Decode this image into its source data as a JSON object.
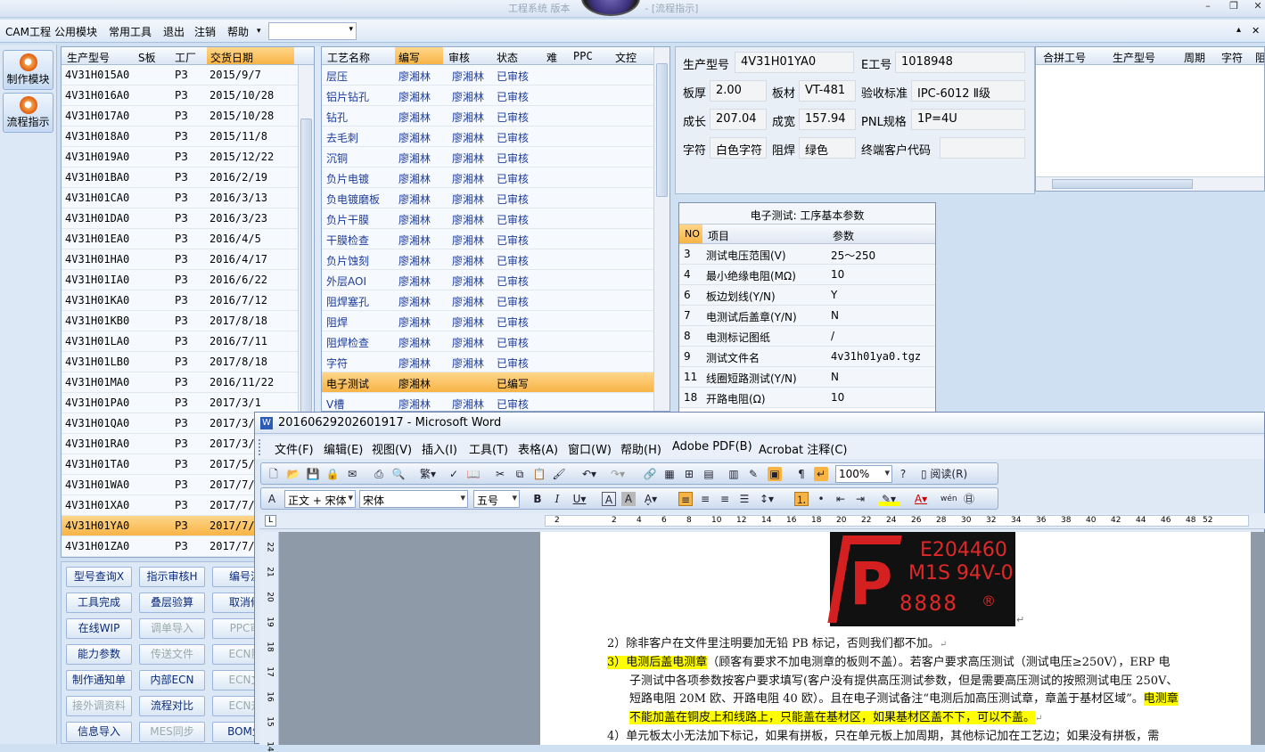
{
  "app": {
    "title": "工程系统   版本",
    "title_suffix": "- [流程指示]",
    "menu": [
      "CAM工程",
      "公用模块",
      "常用工具",
      "退出",
      "注销",
      "帮助"
    ],
    "menu_arrow": "▾",
    "window_controls": [
      "–",
      "❐",
      "✕"
    ],
    "mdi_controls": [
      "▴",
      "✕"
    ]
  },
  "leftnav": {
    "items": [
      {
        "label": "制作模块",
        "icon": "flame-icon"
      },
      {
        "label": "流程指示",
        "icon": "flame-icon"
      }
    ]
  },
  "models": {
    "headers": [
      "生产型号",
      "S板",
      "工厂",
      "交货日期"
    ],
    "rows": [
      [
        "4V31H015A0",
        "",
        "P3",
        "2015/9/7"
      ],
      [
        "4V31H016A0",
        "",
        "P3",
        "2015/10/28"
      ],
      [
        "4V31H017A0",
        "",
        "P3",
        "2015/10/28"
      ],
      [
        "4V31H018A0",
        "",
        "P3",
        "2015/11/8"
      ],
      [
        "4V31H019A0",
        "",
        "P3",
        "2015/12/22"
      ],
      [
        "4V31H01BA0",
        "",
        "P3",
        "2016/2/19"
      ],
      [
        "4V31H01CA0",
        "",
        "P3",
        "2016/3/13"
      ],
      [
        "4V31H01DA0",
        "",
        "P3",
        "2016/3/23"
      ],
      [
        "4V31H01EA0",
        "",
        "P3",
        "2016/4/5"
      ],
      [
        "4V31H01HA0",
        "",
        "P3",
        "2016/4/17"
      ],
      [
        "4V31H01IA0",
        "",
        "P3",
        "2016/6/22"
      ],
      [
        "4V31H01KA0",
        "",
        "P3",
        "2016/7/12"
      ],
      [
        "4V31H01KB0",
        "",
        "P3",
        "2017/8/18"
      ],
      [
        "4V31H01LA0",
        "",
        "P3",
        "2016/7/11"
      ],
      [
        "4V31H01LB0",
        "",
        "P3",
        "2017/8/18"
      ],
      [
        "4V31H01MA0",
        "",
        "P3",
        "2016/11/22"
      ],
      [
        "4V31H01PA0",
        "",
        "P3",
        "2017/3/1"
      ],
      [
        "4V31H01QA0",
        "",
        "P3",
        "2017/3/"
      ],
      [
        "4V31H01RA0",
        "",
        "P3",
        "2017/3/"
      ],
      [
        "4V31H01TA0",
        "",
        "P3",
        "2017/5/"
      ],
      [
        "4V31H01WA0",
        "",
        "P3",
        "2017/7/"
      ],
      [
        "4V31H01XA0",
        "",
        "P3",
        "2017/7/"
      ],
      [
        "4V31H01YA0",
        "",
        "P3",
        "2017/7/"
      ],
      [
        "4V31H01ZA0",
        "",
        "P3",
        "2017/7/"
      ]
    ],
    "selected_index": 22
  },
  "buttons": [
    [
      "型号查询X",
      "指示审核H",
      "编号流"
    ],
    [
      "工具完成",
      "叠层验算",
      "取消修"
    ],
    [
      "在线WIP",
      "调单导入",
      "PPC审"
    ],
    [
      "能力参数",
      "传送文件",
      "ECN影"
    ],
    [
      "制作通知单",
      "内部ECN",
      "ECN文"
    ],
    [
      "接外调资料",
      "流程对比",
      "ECN升"
    ],
    [
      "信息导入",
      "MES同步",
      "BOM生"
    ]
  ],
  "process": {
    "headers": [
      "工艺名称",
      "编写",
      "审核",
      "状态",
      "难",
      "PPC",
      "文控"
    ],
    "rows": [
      [
        "层压",
        "廖湘林",
        "廖湘林",
        "已审核"
      ],
      [
        "铝片钻孔",
        "廖湘林",
        "廖湘林",
        "已审核"
      ],
      [
        "钻孔",
        "廖湘林",
        "廖湘林",
        "已审核"
      ],
      [
        "去毛刺",
        "廖湘林",
        "廖湘林",
        "已审核"
      ],
      [
        "沉铜",
        "廖湘林",
        "廖湘林",
        "已审核"
      ],
      [
        "负片电镀",
        "廖湘林",
        "廖湘林",
        "已审核"
      ],
      [
        "负电镀磨板",
        "廖湘林",
        "廖湘林",
        "已审核"
      ],
      [
        "负片干膜",
        "廖湘林",
        "廖湘林",
        "已审核"
      ],
      [
        "干膜检查",
        "廖湘林",
        "廖湘林",
        "已审核"
      ],
      [
        "负片蚀刻",
        "廖湘林",
        "廖湘林",
        "已审核"
      ],
      [
        "外层AOI",
        "廖湘林",
        "廖湘林",
        "已审核"
      ],
      [
        "阻焊塞孔",
        "廖湘林",
        "廖湘林",
        "已审核"
      ],
      [
        "阻焊",
        "廖湘林",
        "廖湘林",
        "已审核"
      ],
      [
        "阻焊检查",
        "廖湘林",
        "廖湘林",
        "已审核"
      ],
      [
        "字符",
        "廖湘林",
        "廖湘林",
        "已审核"
      ],
      [
        "电子测试",
        "廖湘林",
        "",
        "已编写"
      ],
      [
        "V槽",
        "廖湘林",
        "廖湘林",
        "已审核"
      ]
    ],
    "selected_index": 15
  },
  "info": {
    "model_label": "生产型号",
    "model": "4V31H01YA0",
    "eno_label": "E工号",
    "eno": "1018948",
    "thickness_label": "板厚",
    "thickness": "2.00",
    "material_label": "板材",
    "material": "VT-481",
    "standard_label": "验收标准",
    "standard": "IPC-6012 Ⅱ级",
    "length_label": "成长",
    "length": "207.04",
    "width_label": "成宽",
    "width": "157.94",
    "pnl_label": "PNL规格",
    "pnl": "1P=4U",
    "char_label": "字符",
    "char": "白色字符",
    "mask_label": "阻焊",
    "mask": "绿色",
    "customer_label": "终端客户代码",
    "customer": ""
  },
  "merge": {
    "headers": [
      "合拼工号",
      "生产型号",
      "周期",
      "字符",
      "阻"
    ]
  },
  "params": {
    "title": "电子测试: 工序基本参数",
    "headers": [
      "NO",
      "项目",
      "参数"
    ],
    "rows": [
      [
        "3",
        "测试电压范围(V)",
        "25～250"
      ],
      [
        "4",
        "最小绝缘电阻(MΩ)",
        "10"
      ],
      [
        "6",
        "板边划线(Y/N)",
        "Y"
      ],
      [
        "7",
        "电测试后盖章(Y/N)",
        "N"
      ],
      [
        "8",
        "电测标记图纸",
        "/"
      ],
      [
        "9",
        "测试文件名",
        "4v31h01ya0.tgz"
      ],
      [
        "11",
        "线圈短路测试(Y/N)",
        "N"
      ],
      [
        "18",
        "开路电阻(Ω)",
        "10"
      ]
    ]
  },
  "word": {
    "title": "20160629202601917 - Microsoft Word",
    "menu": [
      "文件(F)",
      "编辑(E)",
      "视图(V)",
      "插入(I)",
      "工具(T)",
      "表格(A)",
      "窗口(W)",
      "帮助(H)",
      "Adobe PDF(B)",
      "Acrobat 注释(C)"
    ],
    "zoom": "100%",
    "read_label": "阅读(R)",
    "style": "正文 + 宋体",
    "font": "宋体",
    "size": "五号",
    "ruler_ticks": [
      "2",
      "2",
      "4",
      "6",
      "8",
      "10",
      "12",
      "14",
      "16",
      "18",
      "20",
      "22",
      "24",
      "26",
      "28",
      "30",
      "32",
      "34",
      "36",
      "38",
      "40",
      "42",
      "44",
      "46",
      "48",
      "52"
    ],
    "vruler_ticks": [
      "22",
      "21",
      "20",
      "19",
      "18",
      "17",
      "16",
      "15",
      "14"
    ],
    "ul_mark": {
      "line1": "E204460",
      "line2": "M1S 94V-0",
      "line3": "8888",
      "logo": "P",
      "badge": "®"
    },
    "lines": [
      {
        "num": "2）",
        "text": "除非客户在文件里注明要加无铅 PB 标记，否则我们都不加。"
      },
      {
        "num": "3）",
        "hl1": "电测后盖电测章",
        "text": "（顾客有要求不加电测章的板则不盖）。若客户要求高压测试（测试电压≥250V），ERP 电"
      },
      {
        "text": "子测试中各项参数按客户要求填写(客户没有提供高压测试参数，但是需要高压测试的按照测试电压 250V、"
      },
      {
        "text": "短路电阻 20M 欧、开路电阻 40 欧）。且在电子测试备注“电测后加高压测试章，章盖于基材区域”。",
        "hl2": "电测章"
      },
      {
        "hl3": "不能加盖在铜皮上和线路上，只能盖在基材区，如果基材区盖不下，可以不盖。"
      },
      {
        "num": "4）",
        "text": "单元板太小无法加下标记，如果有拼板，只在单元板上加周期，其他标记加在工艺边；如果没有拼板，需"
      }
    ]
  }
}
